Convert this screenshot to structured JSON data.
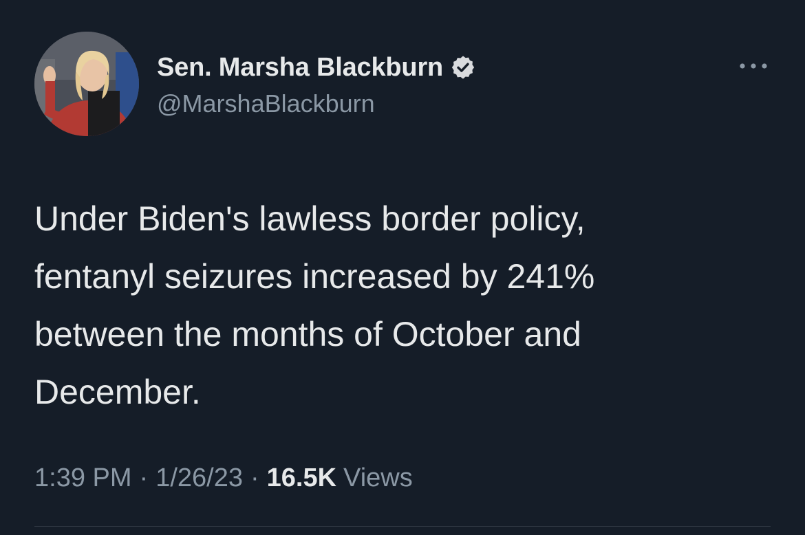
{
  "author": {
    "display_name": "Sen. Marsha Blackburn",
    "handle": "@MarshaBlackburn",
    "verified": true,
    "verified_icon": "verified-badge-icon",
    "avatar_icon": "avatar"
  },
  "tweet": {
    "text": "Under Biden's lawless border policy,\nfentanyl seizures increased by 241%\nbetween the months of October and\nDecember."
  },
  "meta": {
    "time": "1:39 PM",
    "separator": "·",
    "date": "1/26/23",
    "views_count": "16.5K",
    "views_label": "Views"
  },
  "colors": {
    "background": "#151d28",
    "primary_text": "#e7e9ea",
    "secondary_text": "#8b98a5",
    "verified_badge": "#d9dbde"
  },
  "more_menu_icon": "more-dots-icon"
}
